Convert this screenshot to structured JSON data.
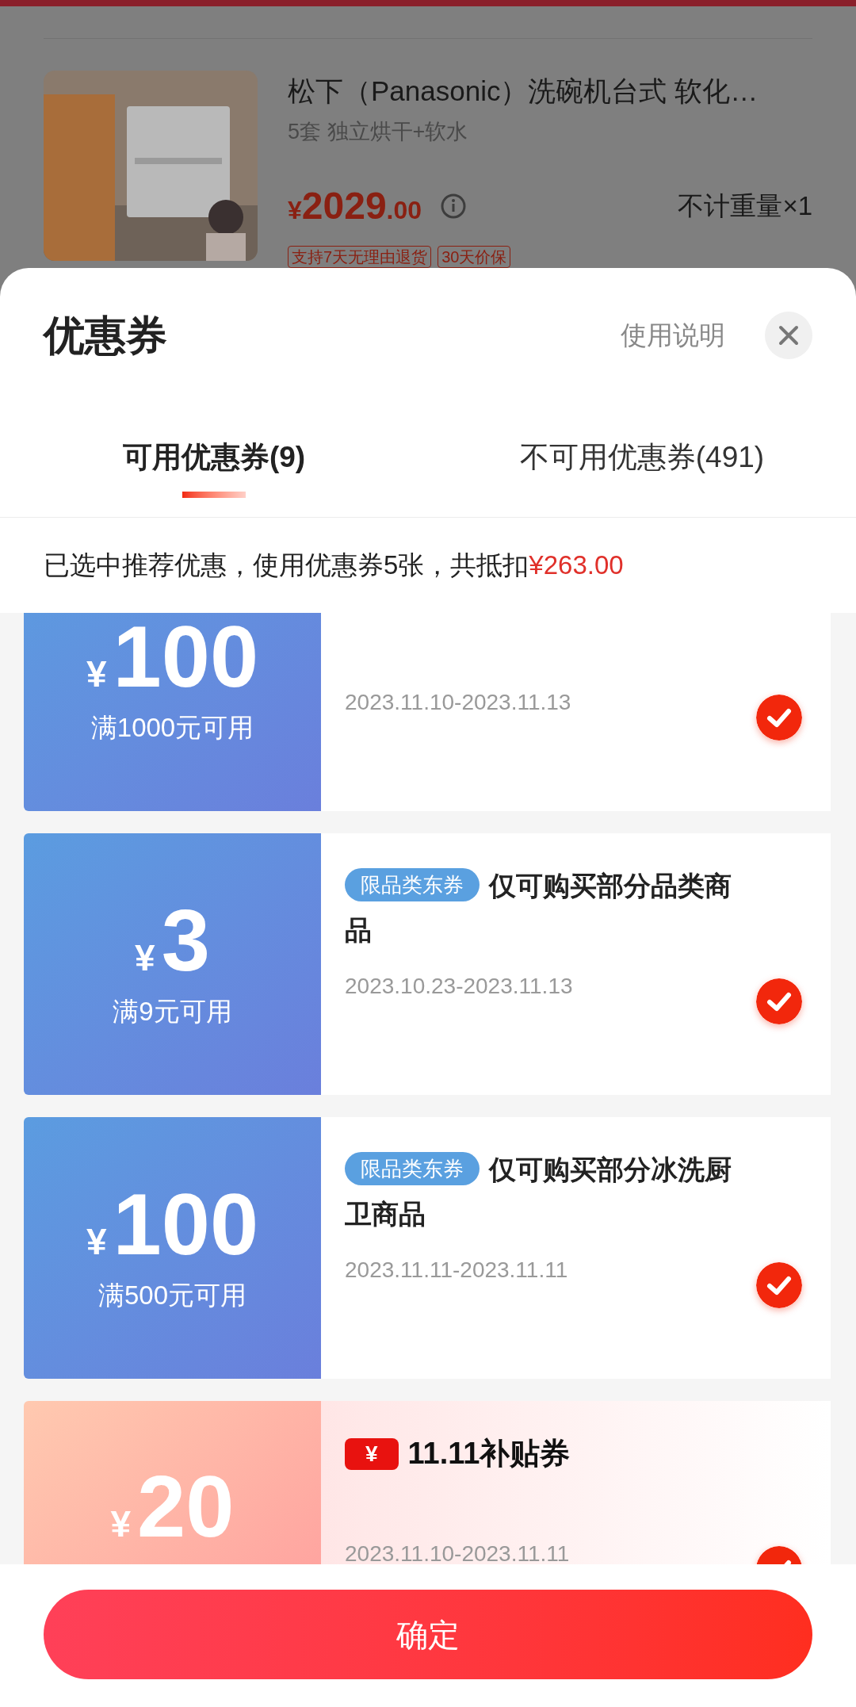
{
  "product": {
    "title": "松下（Panasonic）洗碗机台式 软化…",
    "subtitle": "5套 独立烘干+软水",
    "price_symbol": "¥",
    "price_int": "2029",
    "price_dec": ".00",
    "quantity": "不计重量×1",
    "tags": [
      "支持7天无理由退货",
      "30天价保"
    ]
  },
  "sheet": {
    "title": "优惠券",
    "help_link": "使用说明"
  },
  "tabs": [
    {
      "label": "可用优惠券(9)",
      "selected": true
    },
    {
      "label": "不可用优惠券(491)",
      "selected": false
    }
  ],
  "summary": {
    "text": "已选中推荐优惠，使用优惠券5张，共抵扣",
    "amount": "¥263.00"
  },
  "coupons": [
    {
      "kind": "standard",
      "symbol": "¥",
      "amount": "100",
      "condition": "满1000元可用",
      "date": "2023.11.10-2023.11.13",
      "checked": true
    },
    {
      "kind": "standard",
      "symbol": "¥",
      "amount": "3",
      "condition": "满9元可用",
      "tag": "限品类东券",
      "title": "仅可购买部分品类商品",
      "date": "2023.10.23-2023.11.13",
      "checked": true
    },
    {
      "kind": "standard",
      "symbol": "¥",
      "amount": "100",
      "condition": "满500元可用",
      "tag": "限品类东券",
      "title": "仅可购买部分冰洗厨卫商品",
      "date": "2023.11.11-2023.11.11",
      "checked": true
    },
    {
      "kind": "subsidy",
      "symbol": "¥",
      "amount": "20",
      "badge_symbol": "¥",
      "title": "11.11补贴券",
      "date": "2023.11.10-2023.11.11",
      "checked": true
    }
  ],
  "confirm_button": "确定"
}
